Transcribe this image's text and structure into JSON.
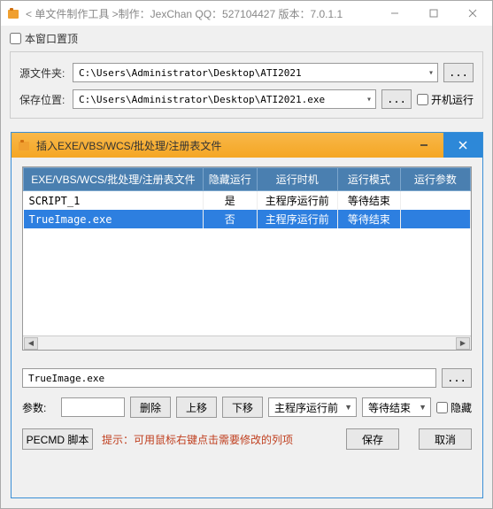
{
  "main": {
    "title": "< 单文件制作工具 >制作：JexChan   QQ：527104427   版本：7.0.1.1",
    "topCheckbox": "本窗口置顶",
    "srcLabel": "源文件夹:",
    "srcPath": "C:\\Users\\Administrator\\Desktop\\ATI2021",
    "saveLabel": "保存位置:",
    "savePath": "C:\\Users\\Administrator\\Desktop\\ATI2021.exe",
    "browse": "...",
    "autorun": "开机运行"
  },
  "inner": {
    "title": "插入EXE/VBS/WCS/批处理/注册表文件",
    "cols": {
      "c1": "EXE/VBS/WCS/批处理/注册表文件",
      "c2": "隐藏运行",
      "c3": "运行时机",
      "c4": "运行模式",
      "c5": "运行参数"
    },
    "rows": [
      {
        "file": "SCRIPT_1",
        "hidden": "是",
        "timing": "主程序运行前",
        "mode": "等待结束",
        "param": ""
      },
      {
        "file": "TrueImage.exe",
        "hidden": "否",
        "timing": "主程序运行前",
        "mode": "等待结束",
        "param": ""
      }
    ],
    "fileInput": "TrueImage.exe",
    "browse": "...",
    "params": {
      "label": "参数:",
      "delete": "删除",
      "up": "上移",
      "down": "下移",
      "timing": "主程序运行前",
      "mode": "等待结束",
      "hideLabel": "隐藏"
    },
    "pecmd": "PECMD 脚本",
    "hint": "提示：可用鼠标右键点击需要修改的列项",
    "save": "保存",
    "cancel": "取消"
  }
}
